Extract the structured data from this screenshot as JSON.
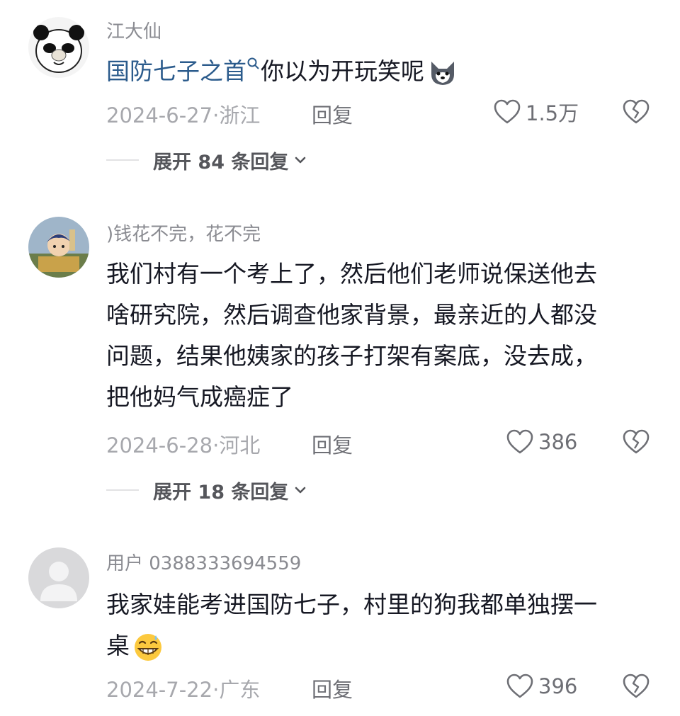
{
  "comments": [
    {
      "username": "江大仙",
      "content_link": "国防七子之首",
      "content_text": "你以为开玩笑呢",
      "content_emoji": "wolf-face-emoji",
      "date": "2024-6-27",
      "location": "浙江",
      "reply_label": "回复",
      "likes": "1.5万",
      "expand": {
        "prefix": "展开",
        "count": "84",
        "suffix": "条回复"
      },
      "avatar": "panda-meme-avatar"
    },
    {
      "username": ")钱花不完，花不完",
      "content_lines": [
        "我们村有一个考上了，然后他们老师说保送他去",
        "啥研究院，然后调查他家背景，最亲近的人都没",
        "问题，结果他姨家的孩子打架有案底，没去成，",
        "把他妈气成癌症了"
      ],
      "date": "2024-6-28",
      "location": "河北",
      "reply_label": "回复",
      "likes": "386",
      "expand": {
        "prefix": "展开",
        "count": "18",
        "suffix": "条回复"
      },
      "avatar": "cartoon-avatar"
    },
    {
      "username": "用户 0388333694559",
      "content_lines": [
        "我家娃能考进国防七子，村里的狗我都单独摆一",
        "桌"
      ],
      "content_emoji": "grinning-sweat-emoji",
      "date": "2024-7-22",
      "location": "广东",
      "reply_label": "回复",
      "likes": "396",
      "avatar": "default-user-avatar"
    }
  ],
  "colors": {
    "link": "#2b5b8c",
    "text": "#161823",
    "meta": "#a7a8ad",
    "icon": "#6e6f75"
  },
  "icons": {
    "like": "heart-outline-icon",
    "dislike": "broken-heart-icon",
    "expand": "chevron-down-icon",
    "search": "search-icon"
  }
}
